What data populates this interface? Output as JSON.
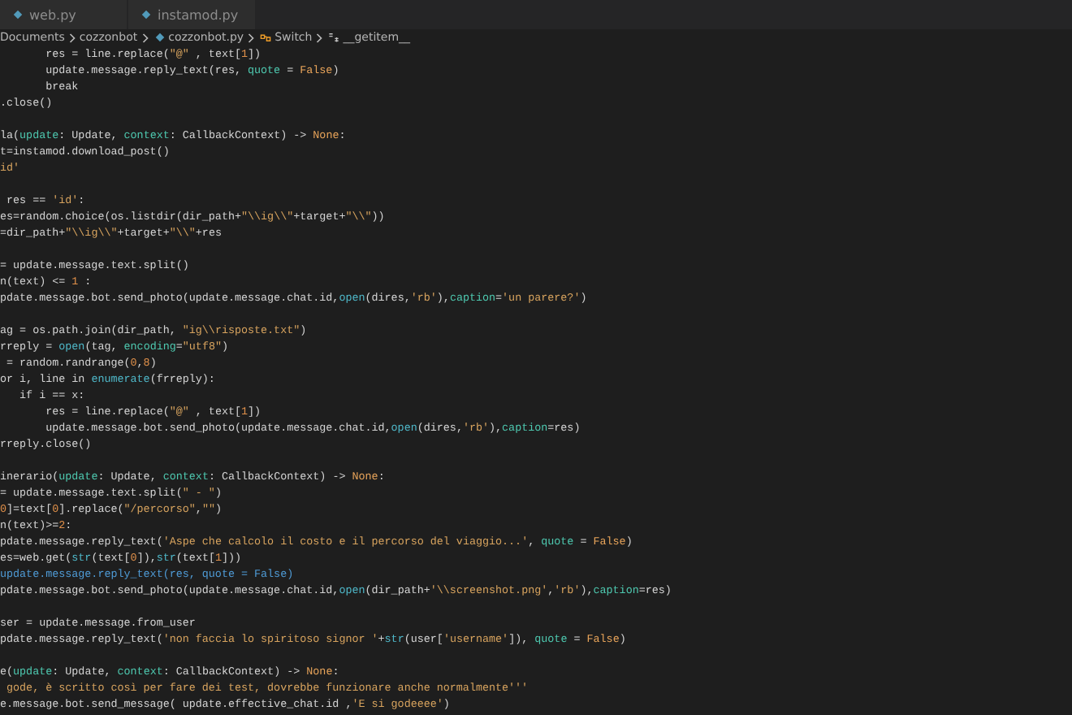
{
  "tabs": [
    {
      "label": "web.py",
      "selected": false
    },
    {
      "label": "instamod.py",
      "selected": false
    }
  ],
  "breadcrumb": [
    {
      "label": "Documents",
      "kind": "folder"
    },
    {
      "label": "cozzonbot",
      "kind": "folder"
    },
    {
      "label": "cozzonbot.py",
      "kind": "file"
    },
    {
      "label": "Switch",
      "kind": "class"
    },
    {
      "label": "__getitem__",
      "kind": "method"
    }
  ],
  "code_lines": [
    {
      "kind": "code",
      "tokens": [
        {
          "text": "       res = line.replace(",
          "kind": "t"
        },
        {
          "text": "\"@\"",
          "kind": "s"
        },
        {
          "text": " , text[",
          "kind": "t"
        },
        {
          "text": "1",
          "kind": "n"
        },
        {
          "text": "])",
          "kind": "t"
        }
      ]
    },
    {
      "kind": "code",
      "tokens": [
        {
          "text": "       update.message.reply_text(res, ",
          "kind": "t"
        },
        {
          "text": "quote",
          "kind": "p"
        },
        {
          "text": " = ",
          "kind": "t"
        },
        {
          "text": "False",
          "kind": "k"
        },
        {
          "text": ")",
          "kind": "t"
        }
      ]
    },
    {
      "kind": "code",
      "tokens": [
        {
          "text": "       break",
          "kind": "t"
        }
      ]
    },
    {
      "kind": "code",
      "tokens": [
        {
          "text": ".close()",
          "kind": "t"
        }
      ]
    },
    {
      "kind": "blank"
    },
    {
      "kind": "code",
      "tokens": [
        {
          "text": "la(",
          "kind": "t"
        },
        {
          "text": "update",
          "kind": "p"
        },
        {
          "text": ": Update, ",
          "kind": "t"
        },
        {
          "text": "context",
          "kind": "p"
        },
        {
          "text": ": CallbackContext) -> ",
          "kind": "t"
        },
        {
          "text": "None",
          "kind": "k"
        },
        {
          "text": ":",
          "kind": "t"
        }
      ]
    },
    {
      "kind": "code",
      "tokens": [
        {
          "text": "t=instamod.download_post()",
          "kind": "t"
        }
      ]
    },
    {
      "kind": "code",
      "tokens": [
        {
          "text": "id'",
          "kind": "s"
        }
      ]
    },
    {
      "kind": "blank"
    },
    {
      "kind": "code",
      "tokens": [
        {
          "text": " res == ",
          "kind": "t"
        },
        {
          "text": "'id'",
          "kind": "s"
        },
        {
          "text": ":",
          "kind": "t"
        }
      ]
    },
    {
      "kind": "code",
      "tokens": [
        {
          "text": "es=random.choice(os.listdir(dir_path+",
          "kind": "t"
        },
        {
          "text": "\"\\\\ig\\\\\"",
          "kind": "s"
        },
        {
          "text": "+target+",
          "kind": "t"
        },
        {
          "text": "\"\\\\\"",
          "kind": "s"
        },
        {
          "text": "))",
          "kind": "t"
        }
      ]
    },
    {
      "kind": "code",
      "tokens": [
        {
          "text": "=dir_path+",
          "kind": "t"
        },
        {
          "text": "\"\\\\ig\\\\\"",
          "kind": "s"
        },
        {
          "text": "+target+",
          "kind": "t"
        },
        {
          "text": "\"\\\\\"",
          "kind": "s"
        },
        {
          "text": "+res",
          "kind": "t"
        }
      ]
    },
    {
      "kind": "blank"
    },
    {
      "kind": "code",
      "tokens": [
        {
          "text": "= update.message.text.split()",
          "kind": "t"
        }
      ]
    },
    {
      "kind": "code",
      "tokens": [
        {
          "text": "n(text) <= ",
          "kind": "t"
        },
        {
          "text": "1",
          "kind": "n"
        },
        {
          "text": " :",
          "kind": "t"
        }
      ]
    },
    {
      "kind": "code",
      "tokens": [
        {
          "text": "pdate.message.bot.send_photo(update.message.chat.id,",
          "kind": "t"
        },
        {
          "text": "open",
          "kind": "f"
        },
        {
          "text": "(dires,",
          "kind": "t"
        },
        {
          "text": "'rb'",
          "kind": "s"
        },
        {
          "text": "),",
          "kind": "t"
        },
        {
          "text": "caption",
          "kind": "p"
        },
        {
          "text": "=",
          "kind": "t"
        },
        {
          "text": "'un parere?'",
          "kind": "s"
        },
        {
          "text": ")",
          "kind": "t"
        }
      ]
    },
    {
      "kind": "blank"
    },
    {
      "kind": "code",
      "tokens": [
        {
          "text": "ag = os.path.join(dir_path, ",
          "kind": "t"
        },
        {
          "text": "\"ig\\\\risposte.txt\"",
          "kind": "s"
        },
        {
          "text": ")",
          "kind": "t"
        }
      ]
    },
    {
      "kind": "code",
      "tokens": [
        {
          "text": "rreply = ",
          "kind": "t"
        },
        {
          "text": "open",
          "kind": "f"
        },
        {
          "text": "(tag, ",
          "kind": "t"
        },
        {
          "text": "encoding",
          "kind": "p"
        },
        {
          "text": "=",
          "kind": "t"
        },
        {
          "text": "\"utf8\"",
          "kind": "s"
        },
        {
          "text": ")",
          "kind": "t"
        }
      ]
    },
    {
      "kind": "code",
      "tokens": [
        {
          "text": " = random.randrange(",
          "kind": "t"
        },
        {
          "text": "0",
          "kind": "n"
        },
        {
          "text": ",",
          "kind": "t"
        },
        {
          "text": "8",
          "kind": "n"
        },
        {
          "text": ")",
          "kind": "t"
        }
      ]
    },
    {
      "kind": "code",
      "tokens": [
        {
          "text": "or i, line in ",
          "kind": "t"
        },
        {
          "text": "enumerate",
          "kind": "f"
        },
        {
          "text": "(frreply):",
          "kind": "t"
        }
      ]
    },
    {
      "kind": "code",
      "tokens": [
        {
          "text": "   if i == x:",
          "kind": "t"
        }
      ]
    },
    {
      "kind": "code",
      "tokens": [
        {
          "text": "       res = line.replace(",
          "kind": "t"
        },
        {
          "text": "\"@\"",
          "kind": "s"
        },
        {
          "text": " , text[",
          "kind": "t"
        },
        {
          "text": "1",
          "kind": "n"
        },
        {
          "text": "])",
          "kind": "t"
        }
      ]
    },
    {
      "kind": "code",
      "tokens": [
        {
          "text": "       update.message.bot.send_photo(update.message.chat.id,",
          "kind": "t"
        },
        {
          "text": "open",
          "kind": "f"
        },
        {
          "text": "(dires,",
          "kind": "t"
        },
        {
          "text": "'rb'",
          "kind": "s"
        },
        {
          "text": "),",
          "kind": "t"
        },
        {
          "text": "caption",
          "kind": "p"
        },
        {
          "text": "=res)",
          "kind": "t"
        }
      ]
    },
    {
      "kind": "code",
      "tokens": [
        {
          "text": "rreply.close()",
          "kind": "t"
        }
      ]
    },
    {
      "kind": "blank"
    },
    {
      "kind": "code",
      "tokens": [
        {
          "text": "inerario(",
          "kind": "t"
        },
        {
          "text": "update",
          "kind": "p"
        },
        {
          "text": ": Update, ",
          "kind": "t"
        },
        {
          "text": "context",
          "kind": "p"
        },
        {
          "text": ": CallbackContext) -> ",
          "kind": "t"
        },
        {
          "text": "None",
          "kind": "k"
        },
        {
          "text": ":",
          "kind": "t"
        }
      ]
    },
    {
      "kind": "code",
      "tokens": [
        {
          "text": "= update.message.text.split(",
          "kind": "t"
        },
        {
          "text": "\" - \"",
          "kind": "s"
        },
        {
          "text": ")",
          "kind": "t"
        }
      ]
    },
    {
      "kind": "code",
      "tokens": [
        {
          "text": "0",
          "kind": "n"
        },
        {
          "text": "]=text[",
          "kind": "t"
        },
        {
          "text": "0",
          "kind": "n"
        },
        {
          "text": "].replace(",
          "kind": "t"
        },
        {
          "text": "\"/percorso\"",
          "kind": "s"
        },
        {
          "text": ",",
          "kind": "t"
        },
        {
          "text": "\"\"",
          "kind": "s"
        },
        {
          "text": ")",
          "kind": "t"
        }
      ]
    },
    {
      "kind": "code",
      "tokens": [
        {
          "text": "n(text)>=",
          "kind": "t"
        },
        {
          "text": "2",
          "kind": "n"
        },
        {
          "text": ":",
          "kind": "t"
        }
      ]
    },
    {
      "kind": "code",
      "tokens": [
        {
          "text": "pdate.message.reply_text(",
          "kind": "t"
        },
        {
          "text": "'Aspe che calcolo il costo e il percorso del viaggio...'",
          "kind": "s"
        },
        {
          "text": ", ",
          "kind": "t"
        },
        {
          "text": "quote",
          "kind": "p"
        },
        {
          "text": " = ",
          "kind": "t"
        },
        {
          "text": "False",
          "kind": "k"
        },
        {
          "text": ")",
          "kind": "t"
        }
      ]
    },
    {
      "kind": "code",
      "tokens": [
        {
          "text": "es=web.get(",
          "kind": "t"
        },
        {
          "text": "str",
          "kind": "f"
        },
        {
          "text": "(text[",
          "kind": "t"
        },
        {
          "text": "0",
          "kind": "n"
        },
        {
          "text": "]),",
          "kind": "t"
        },
        {
          "text": "str",
          "kind": "f"
        },
        {
          "text": "(text[",
          "kind": "t"
        },
        {
          "text": "1",
          "kind": "n"
        },
        {
          "text": "]))",
          "kind": "t"
        }
      ]
    },
    {
      "kind": "code",
      "tokens": [
        {
          "text": "update.message.reply_text(res, quote = False)",
          "kind": "b"
        }
      ]
    },
    {
      "kind": "code",
      "tokens": [
        {
          "text": "pdate.message.bot.send_photo(update.message.chat.id,",
          "kind": "t"
        },
        {
          "text": "open",
          "kind": "f"
        },
        {
          "text": "(dir_path+",
          "kind": "t"
        },
        {
          "text": "'\\\\screenshot.png'",
          "kind": "s"
        },
        {
          "text": ",",
          "kind": "t"
        },
        {
          "text": "'rb'",
          "kind": "s"
        },
        {
          "text": "),",
          "kind": "t"
        },
        {
          "text": "caption",
          "kind": "p"
        },
        {
          "text": "=res)",
          "kind": "t"
        }
      ]
    },
    {
      "kind": "blank"
    },
    {
      "kind": "code",
      "tokens": [
        {
          "text": "ser = update.message.from_user",
          "kind": "t"
        }
      ]
    },
    {
      "kind": "code",
      "tokens": [
        {
          "text": "pdate.message.reply_text(",
          "kind": "t"
        },
        {
          "text": "'non faccia lo spiritoso signor '",
          "kind": "s"
        },
        {
          "text": "+",
          "kind": "t"
        },
        {
          "text": "str",
          "kind": "f"
        },
        {
          "text": "(user[",
          "kind": "t"
        },
        {
          "text": "'username'",
          "kind": "s"
        },
        {
          "text": "]), ",
          "kind": "t"
        },
        {
          "text": "quote",
          "kind": "p"
        },
        {
          "text": " = ",
          "kind": "t"
        },
        {
          "text": "False",
          "kind": "k"
        },
        {
          "text": ")",
          "kind": "t"
        }
      ]
    },
    {
      "kind": "blank"
    },
    {
      "kind": "code",
      "tokens": [
        {
          "text": "e(",
          "kind": "t"
        },
        {
          "text": "update",
          "kind": "p"
        },
        {
          "text": ": Update, ",
          "kind": "t"
        },
        {
          "text": "context",
          "kind": "p"
        },
        {
          "text": ": CallbackContext) -> ",
          "kind": "t"
        },
        {
          "text": "None",
          "kind": "k"
        },
        {
          "text": ":",
          "kind": "t"
        }
      ]
    },
    {
      "kind": "code",
      "tokens": [
        {
          "text": " gode, è scritto così per fare dei test, dovrebbe funzionare anche normalmente'''",
          "kind": "s"
        }
      ]
    },
    {
      "kind": "code",
      "tokens": [
        {
          "text": "e.message.bot.send_message( update.effective_chat.id ,",
          "kind": "t"
        },
        {
          "text": "'E si godeeee'",
          "kind": "s"
        },
        {
          "text": ")",
          "kind": "t"
        }
      ]
    }
  ]
}
